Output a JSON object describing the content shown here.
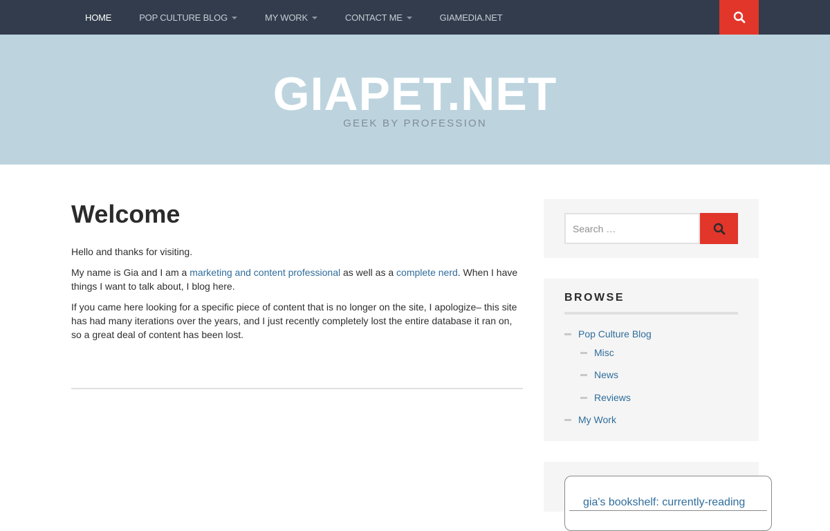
{
  "nav": {
    "items": [
      {
        "label": "HOME",
        "active": true,
        "has_caret": false
      },
      {
        "label": "POP CULTURE BLOG",
        "active": false,
        "has_caret": true
      },
      {
        "label": "MY WORK",
        "active": false,
        "has_caret": true
      },
      {
        "label": "CONTACT ME",
        "active": false,
        "has_caret": true
      },
      {
        "label": "GIAMEDIA.NET",
        "active": false,
        "has_caret": false
      }
    ],
    "search_icon": "search-icon"
  },
  "header": {
    "title": "GIAPET.NET",
    "tagline": "GEEK BY PROFESSION"
  },
  "entry": {
    "title": "Welcome",
    "p1": "Hello and thanks for visiting.",
    "p2_before": "My name is Gia and I am a ",
    "p2_link1": "marketing and content professional",
    "p2_middle": " as well as a ",
    "p2_link2": "complete nerd",
    "p2_after": ". When I have things I want to talk about, I blog here.",
    "p3": "If you came here looking for a specific piece of content that is no longer on the site, I apologize– this site has had many iterations over the years, and I just recently completely lost the entire database it ran on, so a great deal of content has been lost."
  },
  "sidebar": {
    "search": {
      "placeholder": "Search …",
      "icon": "search-icon"
    },
    "browse": {
      "title": "BROWSE",
      "items": [
        {
          "label": "Pop Culture Blog",
          "level": 0
        },
        {
          "label": "Misc",
          "level": 1
        },
        {
          "label": "News",
          "level": 1
        },
        {
          "label": "Reviews",
          "level": 1
        },
        {
          "label": "My Work",
          "level": 0
        }
      ]
    },
    "bookshelf": {
      "link": "gia's bookshelf: currently-reading"
    }
  },
  "colors": {
    "nav_bg": "#323c4c",
    "accent_red": "#e2362b",
    "header_bg": "#bdd4df",
    "link": "#2f6d9c"
  }
}
